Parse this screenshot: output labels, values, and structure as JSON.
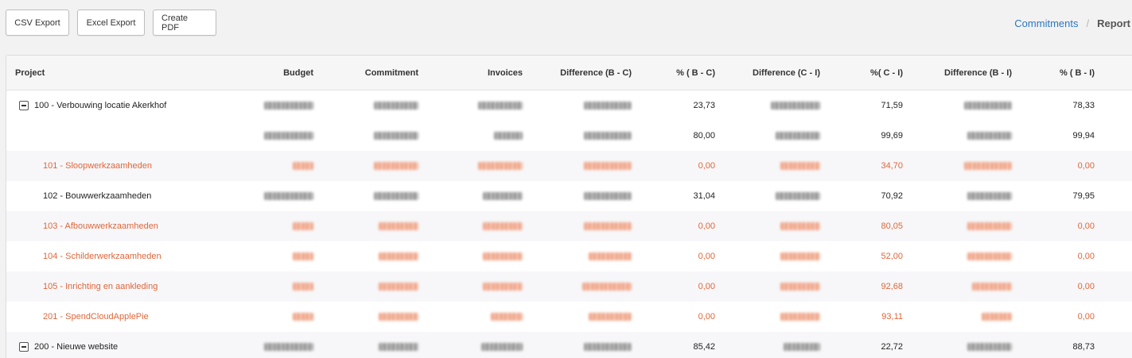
{
  "toolbar": {
    "csv_label": "CSV Export",
    "excel_label": "Excel Export",
    "pdf_label": "Create PDF"
  },
  "breadcrumb": {
    "link": "Commitments",
    "separator": "/",
    "current": "Report"
  },
  "table": {
    "headers": {
      "project": "Project",
      "budget": "Budget",
      "commitment": "Commitment",
      "invoices": "Invoices",
      "diff_bc": "Difference (B - C)",
      "pct_bc": "% ( B - C)",
      "diff_ci": "Difference (C - I)",
      "pct_ci": "%( C - I)",
      "diff_bi": "Difference (B - I)",
      "pct_bi": "% ( B - I)"
    },
    "rows": [
      {
        "project": "100 - Verbouwing locatie Akerkhof",
        "pct_bc": "23,73",
        "pct_ci": "71,59",
        "pct_bi": "78,33"
      },
      {
        "project": "",
        "pct_bc": "80,00",
        "pct_ci": "99,69",
        "pct_bi": "99,94"
      },
      {
        "project": "101 - Sloopwerkzaamheden",
        "pct_bc": "0,00",
        "pct_ci": "34,70",
        "pct_bi": "0,00"
      },
      {
        "project": "102 - Bouwwerkzaamheden",
        "pct_bc": "31,04",
        "pct_ci": "70,92",
        "pct_bi": "79,95"
      },
      {
        "project": "103 - Afbouwwerkzaamheden",
        "pct_bc": "0,00",
        "pct_ci": "80,05",
        "pct_bi": "0,00"
      },
      {
        "project": "104 - Schilderwerkzaamheden",
        "pct_bc": "0,00",
        "pct_ci": "52,00",
        "pct_bi": "0,00"
      },
      {
        "project": "105 - Inrichting en aankleding",
        "pct_bc": "0,00",
        "pct_ci": "92,68",
        "pct_bi": "0,00"
      },
      {
        "project": "201 - SpendCloudApplePie",
        "pct_bc": "0,00",
        "pct_ci": "93,11",
        "pct_bi": "0,00"
      },
      {
        "project": "200 - Nieuwe website",
        "pct_bc": "85,42",
        "pct_ci": "22,72",
        "pct_bi": "88,73"
      }
    ]
  },
  "colors": {
    "link": "#2a78c2",
    "warning_text": "#e0663a",
    "header_bg": "#f6f6f7",
    "stripe_bg": "#f7f7f9"
  },
  "icons": {
    "collapse": "minus-square-icon"
  }
}
